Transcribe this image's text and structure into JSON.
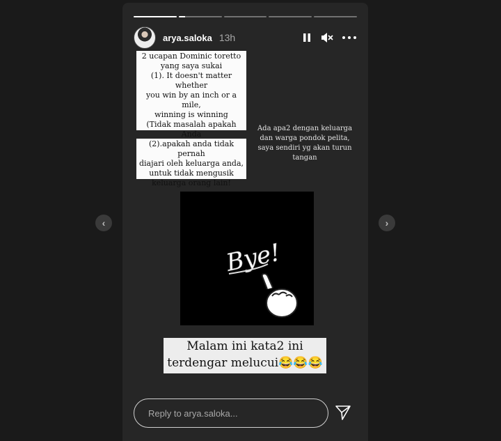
{
  "story": {
    "progress": [
      1,
      0.15,
      0,
      0,
      0
    ],
    "username": "arya.saloka",
    "time": "13h"
  },
  "notes": {
    "quote1": "2 ucapan Dominic toretto\nyang saya sukai\n(1). It doesn't matter whether\nyou win by an inch or a mile,\nwinning is winning\n(Tidak masalah apakah Anda\nmenang satu inci atau satu\nmil, menang berarti menang)",
    "quote2": "(2).apakah anda tidak pernah\ndiajari oleh keluarga anda,\nuntuk tidak mengusik\nkeluarga orang lain!",
    "side": "Ada apa2 dengan keluarga\ndan warga pondok pelita,\nsaya sendiri yg akan turun\ntangan",
    "bye": "Bye!",
    "caption": "Malam ini kata2 ini\nterdengar melucui😂😂😂"
  },
  "reply": {
    "placeholder": "Reply to arya.saloka..."
  },
  "nav": {
    "prev": "‹",
    "next": "›"
  }
}
